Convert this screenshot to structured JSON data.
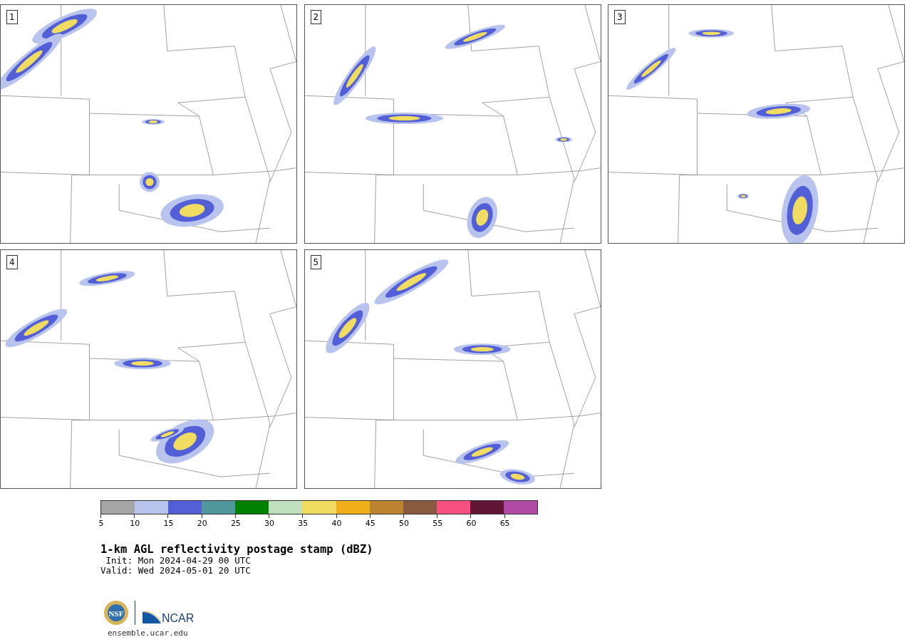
{
  "panels": [
    {
      "label": "1"
    },
    {
      "label": "2"
    },
    {
      "label": "3"
    },
    {
      "label": "4"
    },
    {
      "label": "5"
    }
  ],
  "colorbar": {
    "segments": [
      {
        "color": "#a6a6a6"
      },
      {
        "color": "#b8c4ee"
      },
      {
        "color": "#525fd6"
      },
      {
        "color": "#50979c"
      },
      {
        "color": "#008000"
      },
      {
        "color": "#bfdfbf"
      },
      {
        "color": "#f0dc60"
      },
      {
        "color": "#f0ae1a"
      },
      {
        "color": "#bc8330"
      },
      {
        "color": "#8a5a40"
      },
      {
        "color": "#f65080"
      },
      {
        "color": "#621636"
      },
      {
        "color": "#b04aa4"
      }
    ],
    "ticks": [
      "5",
      "10",
      "15",
      "20",
      "25",
      "30",
      "35",
      "40",
      "45",
      "50",
      "55",
      "60",
      "65"
    ]
  },
  "title": "1-km AGL reflectivity postage stamp (dBZ)",
  "init": " Init: Mon 2024-04-29 00 UTC",
  "valid": "Valid: Wed 2024-05-01 20 UTC",
  "logo": {
    "left": "NSF",
    "right": "NCAR"
  },
  "url": "ensemble.ucar.edu"
}
